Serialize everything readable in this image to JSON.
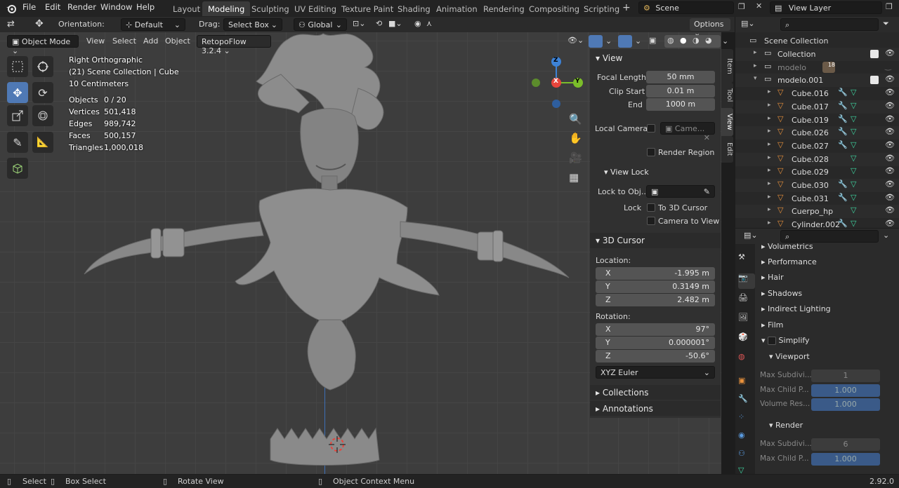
{
  "menu": [
    "File",
    "Edit",
    "Render",
    "Window",
    "Help"
  ],
  "workspaces": [
    "Layout",
    "Modeling",
    "Sculpting",
    "UV Editing",
    "Texture Paint",
    "Shading",
    "Animation",
    "Rendering",
    "Compositing",
    "Scripting"
  ],
  "active_workspace": "Modeling",
  "scene": {
    "label": "Scene"
  },
  "view_layer": {
    "label": "View Layer"
  },
  "header": {
    "orientation_label": "Orientation:",
    "orientation_value": "Default",
    "drag_label": "Drag:",
    "drag_value": "Select Box",
    "transform_space": "Global",
    "options": "Options"
  },
  "header2": {
    "mode": "Object Mode",
    "view": "View",
    "select": "Select",
    "add": "Add",
    "object": "Object",
    "addon": "RetopoFlow 3.2.4"
  },
  "overlay": {
    "view_name": "Right Orthographic",
    "collection": "(21) Scene Collection | Cube",
    "scale": "10 Centimeters",
    "stats": [
      {
        "label": "Objects",
        "value": "0 / 20"
      },
      {
        "label": "Vertices",
        "value": "501,418"
      },
      {
        "label": "Edges",
        "value": "989,742"
      },
      {
        "label": "Faces",
        "value": "500,157"
      },
      {
        "label": "Triangles",
        "value": "1,000,018"
      }
    ]
  },
  "gizmo": {
    "x": "X",
    "y": "Y",
    "z": "Z"
  },
  "npanel": {
    "view_title": "View",
    "focal_length_label": "Focal Length",
    "focal_length": "50 mm",
    "clip_start_label": "Clip Start",
    "clip_start": "0.01 m",
    "end_label": "End",
    "end": "1000 m",
    "local_camera_label": "Local Camera",
    "local_camera_placeholder": "Came...",
    "render_region": "Render Region",
    "view_lock_title": "View Lock",
    "lock_to_obj_label": "Lock to Obj...",
    "lock_label": "Lock",
    "to_3d_cursor": "To 3D Cursor",
    "camera_to_view": "Camera to View",
    "cursor_title": "3D Cursor",
    "location_label": "Location:",
    "loc": [
      {
        "axis": "X",
        "value": "-1.995 m"
      },
      {
        "axis": "Y",
        "value": "0.3149 m"
      },
      {
        "axis": "Z",
        "value": "2.482 m"
      }
    ],
    "rotation_label": "Rotation:",
    "rot": [
      {
        "axis": "X",
        "value": "97°"
      },
      {
        "axis": "Y",
        "value": "0.000001°"
      },
      {
        "axis": "Z",
        "value": "-50.6°"
      }
    ],
    "rot_mode": "XYZ Euler",
    "collections": "Collections",
    "annotations": "Annotations"
  },
  "side_tabs": [
    "Item",
    "Tool",
    "View",
    "Edit"
  ],
  "outliner": {
    "root": "Scene Collection",
    "rows": [
      {
        "name": "Collection",
        "indent": 1
      },
      {
        "name": "modelo",
        "indent": 1,
        "badge": "18"
      },
      {
        "name": "modelo.001",
        "indent": 1
      },
      {
        "name": "Cube.016",
        "indent": 2
      },
      {
        "name": "Cube.017",
        "indent": 2
      },
      {
        "name": "Cube.019",
        "indent": 2
      },
      {
        "name": "Cube.026",
        "indent": 2
      },
      {
        "name": "Cube.027",
        "indent": 2
      },
      {
        "name": "Cube.028",
        "indent": 2
      },
      {
        "name": "Cube.029",
        "indent": 2
      },
      {
        "name": "Cube.030",
        "indent": 2
      },
      {
        "name": "Cube.031",
        "indent": 2
      },
      {
        "name": "Cuerpo_hp",
        "indent": 2
      },
      {
        "name": "Cylinder.002",
        "indent": 2
      }
    ]
  },
  "properties": {
    "items": [
      "Volumetrics",
      "Performance",
      "Hair",
      "Shadows",
      "Indirect Lighting",
      "Film",
      "Simplify"
    ],
    "viewport_title": "Viewport",
    "viewport_fields": [
      {
        "label": "Max Subdivi...",
        "value": "1"
      },
      {
        "label": "Max Child P...",
        "value": "1.000"
      },
      {
        "label": "Volume Res...",
        "value": "1.000"
      }
    ],
    "render_title": "Render",
    "render_fields": [
      {
        "label": "Max Subdivi...",
        "value": "6"
      },
      {
        "label": "Max Child P...",
        "value": "1.000"
      }
    ]
  },
  "status": {
    "select": "Select",
    "box_select": "Box Select",
    "rotate_view": "Rotate View",
    "context_menu": "Object Context Menu",
    "version": "2.92.0"
  },
  "colors": {
    "accent": "#4f79b5",
    "x_axis": "#e8453c",
    "y_axis": "#7bbd2a",
    "z_axis": "#3d82d6",
    "outliner_mesh": "#e8913c",
    "outliner_green": "#3fd7a2"
  }
}
